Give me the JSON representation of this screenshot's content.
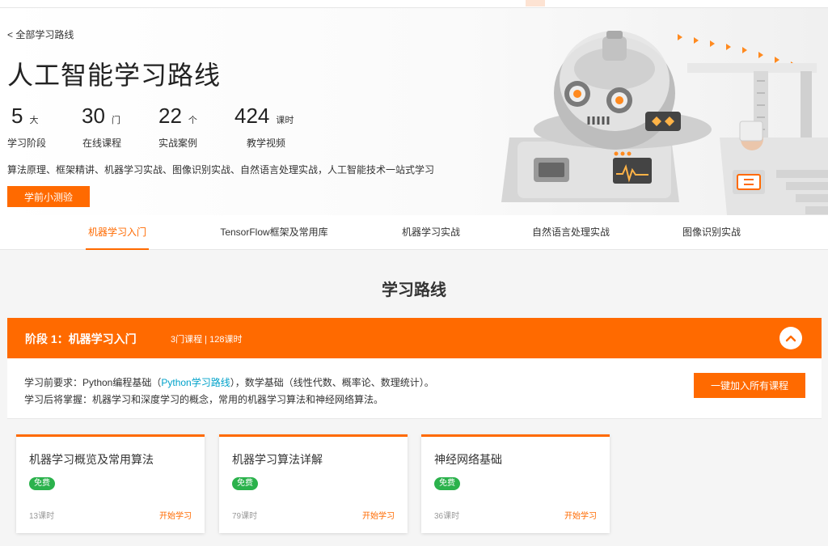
{
  "hero": {
    "back_link": "< 全部学习路线",
    "title": "人工智能学习路线",
    "stats": [
      {
        "num": "5",
        "unit": "大",
        "label": "学习阶段"
      },
      {
        "num": "30",
        "unit": "门",
        "label": "在线课程"
      },
      {
        "num": "22",
        "unit": "个",
        "label": "实战案例"
      },
      {
        "num": "424",
        "unit": "课时",
        "label": "教学视频"
      }
    ],
    "description": "算法原理、框架精讲、机器学习实战、图像识别实战、自然语言处理实战，人工智能技术一站式学习",
    "quiz_button": "学前小测验",
    "accent_color": "#ff6a00"
  },
  "tabs": [
    "机器学习入门",
    "TensorFlow框架及常用库",
    "机器学习实战",
    "自然语言处理实战",
    "图像识别实战"
  ],
  "section_title": "学习路线",
  "stage": {
    "name": "阶段 1：机器学习入门",
    "meta": "3门课程 | 128课时",
    "req_prefix": "学习前要求：Python编程基础（",
    "req_link": "Python学习路线",
    "req_suffix": "），数学基础（线性代数、概率论、数理统计）。",
    "outcome": "学习后将掌握：机器学习和深度学习的概念，常用的机器学习算法和神经网络算法。",
    "join_button": "一键加入所有课程"
  },
  "courses": [
    {
      "title": "机器学习概览及常用算法",
      "badge": "免费",
      "hours": "13课时",
      "action": "开始学习"
    },
    {
      "title": "机器学习算法详解",
      "badge": "免费",
      "hours": "79课时",
      "action": "开始学习"
    },
    {
      "title": "神经网络基础",
      "badge": "免费",
      "hours": "36课时",
      "action": "开始学习"
    }
  ]
}
